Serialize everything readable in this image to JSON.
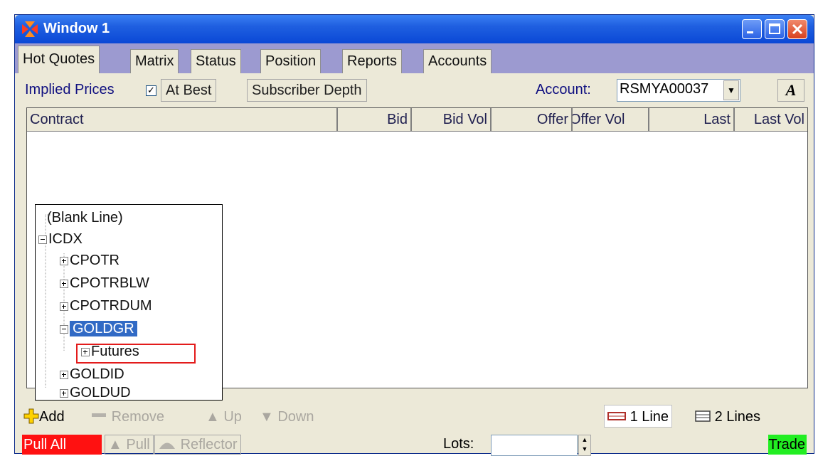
{
  "window": {
    "title": "Window 1"
  },
  "tabs": [
    {
      "label": "Hot Quotes"
    },
    {
      "label": "Matrix"
    },
    {
      "label": "Status"
    },
    {
      "label": "Position"
    },
    {
      "label": "Reports"
    },
    {
      "label": "Accounts"
    }
  ],
  "options": {
    "implied_prices_label": "Implied Prices",
    "implied_prices_checked": true,
    "at_best_label": "At Best",
    "subscriber_depth_label": "Subscriber Depth",
    "account_label": "Account:",
    "account_value": "RSMYA00037",
    "font_button_label": "A"
  },
  "table": {
    "columns": [
      "Contract",
      "Bid",
      "Bid Vol",
      "Offer",
      "Offer Vol",
      "Last",
      "Last Vol"
    ]
  },
  "tree": {
    "items": [
      {
        "label": "(Blank Line)"
      },
      {
        "label": "ICDX"
      },
      {
        "label": "CPOTR"
      },
      {
        "label": "CPOTRBLW"
      },
      {
        "label": "CPOTRDUM"
      },
      {
        "label": "GOLDGR"
      },
      {
        "label": "Futures"
      },
      {
        "label": "GOLDID"
      },
      {
        "label": "GOLDUD"
      }
    ]
  },
  "toolbar": {
    "add": "Add",
    "remove": "Remove",
    "up": "Up",
    "down": "Down",
    "one_line": "1 Line",
    "two_lines": "2 Lines"
  },
  "status": {
    "pull_all": "Pull All",
    "pull": "Pull",
    "reflector": "Reflector",
    "lots_label": "Lots:",
    "lots_value": "",
    "trade": "Trade"
  },
  "colors": {
    "titlebar": "#0a48d6",
    "tab_strip": "#9c9ad0",
    "selection": "#316ac5",
    "pull_all": "#ff1111",
    "trade": "#22ee22",
    "highlight_box": "#e31b1b"
  }
}
